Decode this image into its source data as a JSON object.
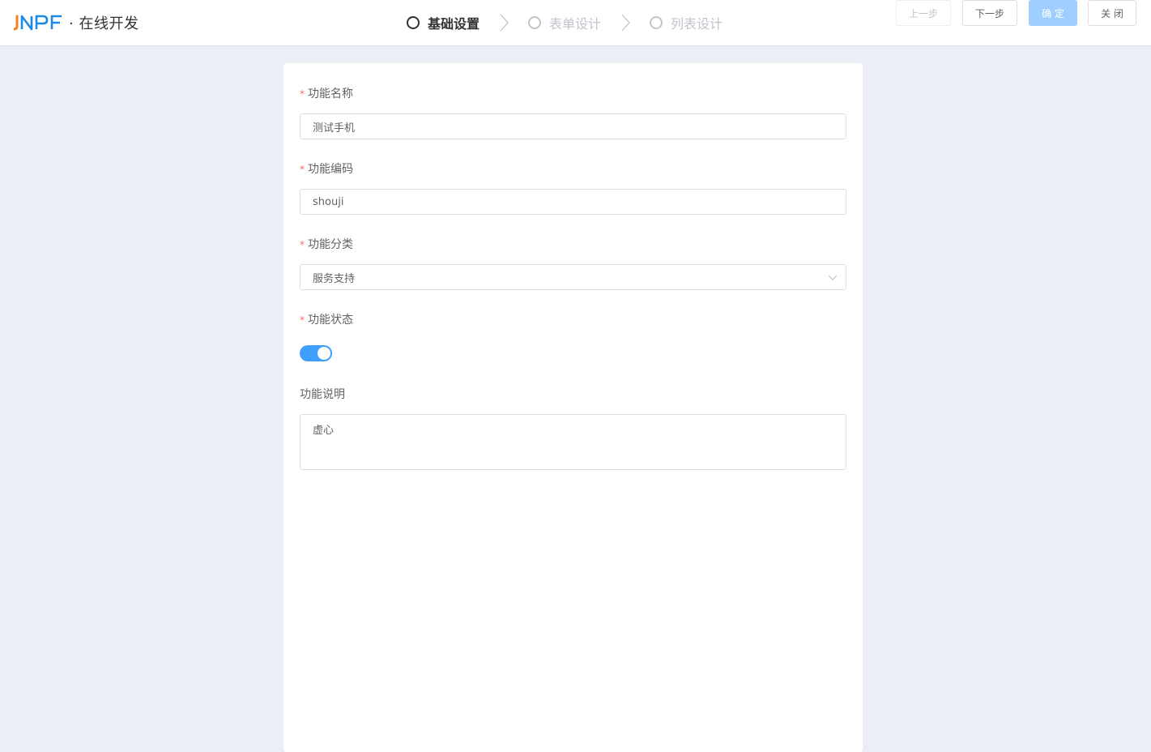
{
  "header": {
    "logo_text": "JNPF",
    "title": "· 在线开发",
    "steps": [
      {
        "label": "基础设置",
        "state": "active"
      },
      {
        "label": "表单设计",
        "state": "inactive"
      },
      {
        "label": "列表设计",
        "state": "inactive"
      }
    ],
    "buttons": {
      "prev": "上一步",
      "next": "下一步",
      "confirm": "确 定",
      "close": "关 闭"
    }
  },
  "form": {
    "name_label": "功能名称",
    "name_value": "测试手机",
    "code_label": "功能编码",
    "code_value": "shouji",
    "category_label": "功能分类",
    "category_value": "服务支持",
    "status_label": "功能状态",
    "status_on": true,
    "desc_label": "功能说明",
    "desc_value": "虚心",
    "required_mark": "*"
  },
  "colors": {
    "primary": "#409eff",
    "primary_disabled": "#a0cfff",
    "required": "#f56c6c",
    "background": "#ebeef5",
    "logo_orange": "#f5821f",
    "logo_blue": "#1e88e5"
  }
}
